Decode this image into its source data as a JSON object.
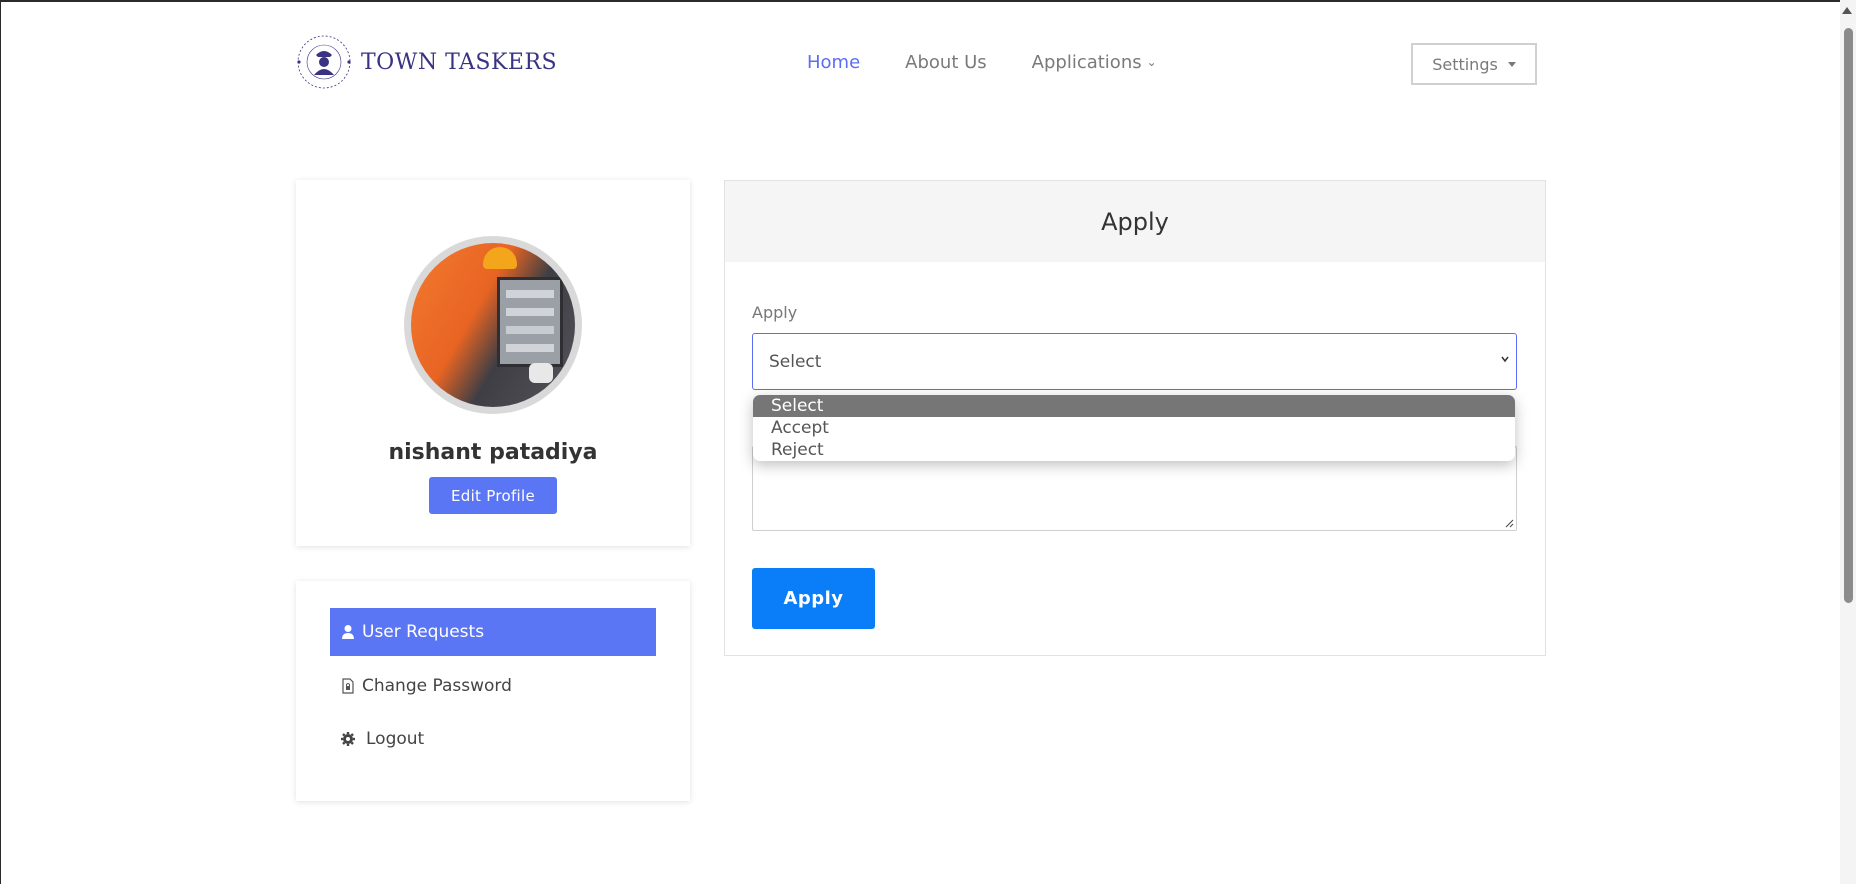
{
  "brand": {
    "name": "TOWN TASKERS",
    "badge_text": "TOWN TASKERS"
  },
  "nav": {
    "items": [
      {
        "label": "Home",
        "active": true
      },
      {
        "label": "About Us",
        "active": false
      },
      {
        "label": "Applications",
        "active": false,
        "has_dropdown": true
      }
    ]
  },
  "settings": {
    "label": "Settings"
  },
  "profile": {
    "name": "nishant patadiya",
    "edit_label": "Edit Profile"
  },
  "menu": {
    "items": [
      {
        "label": "User Requests",
        "icon": "user-icon",
        "active": true
      },
      {
        "label": "Change Password",
        "icon": "file-lock-icon",
        "active": false
      },
      {
        "label": "Logout",
        "icon": "gear-icon",
        "active": false
      }
    ]
  },
  "form": {
    "title": "Apply",
    "field_label": "Apply",
    "select_value": "Select",
    "options": [
      "Select",
      "Accept",
      "Reject"
    ],
    "submit_label": "Apply"
  },
  "colors": {
    "accent": "#5b76f5",
    "nav_active": "#5b6df5",
    "submit": "#0a7ef9",
    "brand_text": "#3a3382"
  }
}
